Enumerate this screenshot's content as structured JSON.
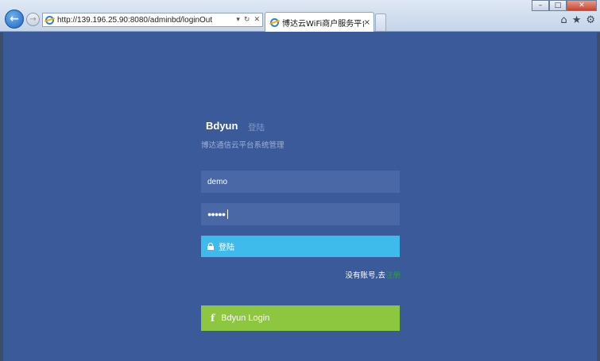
{
  "browser": {
    "url": "http://139.196.25.90:8080/adminbd/loginOut",
    "tab_title": "博达云WiFi商户服务平台登...",
    "tab_close": "×",
    "addr_icons": {
      "dropdown": "▾",
      "refresh": "↻",
      "stop": "✕"
    },
    "window_controls": {
      "minimize": "–",
      "maximize": "□",
      "close": "✕"
    },
    "toolbar_icons": {
      "home": "⌂",
      "favorites": "★",
      "tools": "⚙"
    },
    "nav": {
      "back": "←",
      "forward": "→"
    }
  },
  "login": {
    "brand": "Bdyun",
    "brand_sub": "登陆",
    "subtitle": "博达通信云平台系统管理",
    "username_value": "demo",
    "password_value": "●●●●●",
    "login_button_label": "登陆",
    "signup_prompt": "没有账号,去",
    "signup_link": "注册",
    "social_button_label": "Bdyun Login",
    "social_icon": "f"
  },
  "colors": {
    "page_background": "#3b5a9a",
    "input_background": "#4a68a6",
    "login_button": "#3ebbeb",
    "social_button": "#8dc63f",
    "signup_link": "#2e9d48"
  }
}
